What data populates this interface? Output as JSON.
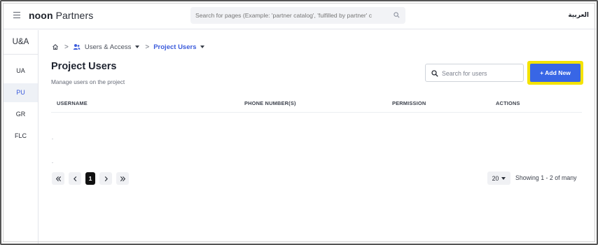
{
  "header": {
    "brand_bold": "noon",
    "brand_rest": " Partners",
    "search_placeholder": "Search for pages (Example: 'partner catalog', 'fulfilled by partner' c",
    "language": "العربية"
  },
  "sidebar": {
    "title": "U&A",
    "items": [
      {
        "label": "UA"
      },
      {
        "label": "PU",
        "active": true
      },
      {
        "label": "GR"
      },
      {
        "label": "FLC"
      }
    ]
  },
  "breadcrumb": {
    "sep1": ">",
    "section": "Users & Access",
    "sep2": ">",
    "current": "Project Users"
  },
  "page": {
    "title": "Project Users",
    "subtitle": "Manage users on the project"
  },
  "search": {
    "placeholder": "Search for users"
  },
  "actions": {
    "add_new": "+ Add New"
  },
  "table": {
    "columns": [
      "USERNAME",
      "PHONE NUMBER(S)",
      "PERMISSION",
      "ACTIONS"
    ]
  },
  "pagination": {
    "current_page": "1",
    "page_size": "20",
    "summary": "Showing 1 - 2 of many"
  },
  "colors": {
    "accent": "#3866e6",
    "highlight": "#f4e300",
    "active_bg": "#eef1f6"
  }
}
